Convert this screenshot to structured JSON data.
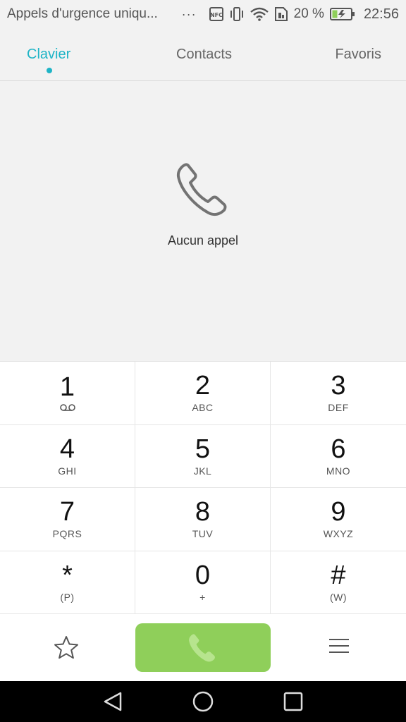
{
  "status_bar": {
    "notification_text": "Appels d'urgence uniqu...",
    "overflow": "···",
    "battery_percent": "20 %",
    "time": "22:56",
    "icons": [
      "nfc-icon",
      "vibrate-icon",
      "wifi-icon",
      "sim-icon",
      "battery-charging-icon"
    ]
  },
  "tabs": [
    {
      "label": "Clavier",
      "active": true
    },
    {
      "label": "Contacts",
      "active": false
    },
    {
      "label": "Favoris",
      "active": false
    }
  ],
  "empty_state": {
    "icon": "phone-outline-icon",
    "text": "Aucun appel"
  },
  "keypad": [
    {
      "digit": "1",
      "sub": "",
      "sub_icon": "voicemail-icon"
    },
    {
      "digit": "2",
      "sub": "ABC"
    },
    {
      "digit": "3",
      "sub": "DEF"
    },
    {
      "digit": "4",
      "sub": "GHI"
    },
    {
      "digit": "5",
      "sub": "JKL"
    },
    {
      "digit": "6",
      "sub": "MNO"
    },
    {
      "digit": "7",
      "sub": "PQRS"
    },
    {
      "digit": "8",
      "sub": "TUV"
    },
    {
      "digit": "9",
      "sub": "WXYZ"
    },
    {
      "digit": "*",
      "sub": "(P)"
    },
    {
      "digit": "0",
      "sub": "+"
    },
    {
      "digit": "#",
      "sub": "(W)"
    }
  ],
  "actions": {
    "favorite_icon": "star-icon",
    "call_icon": "phone-icon",
    "menu_icon": "menu-icon"
  },
  "colors": {
    "accent": "#1eb4c6",
    "call_button": "#8fcf5a"
  }
}
